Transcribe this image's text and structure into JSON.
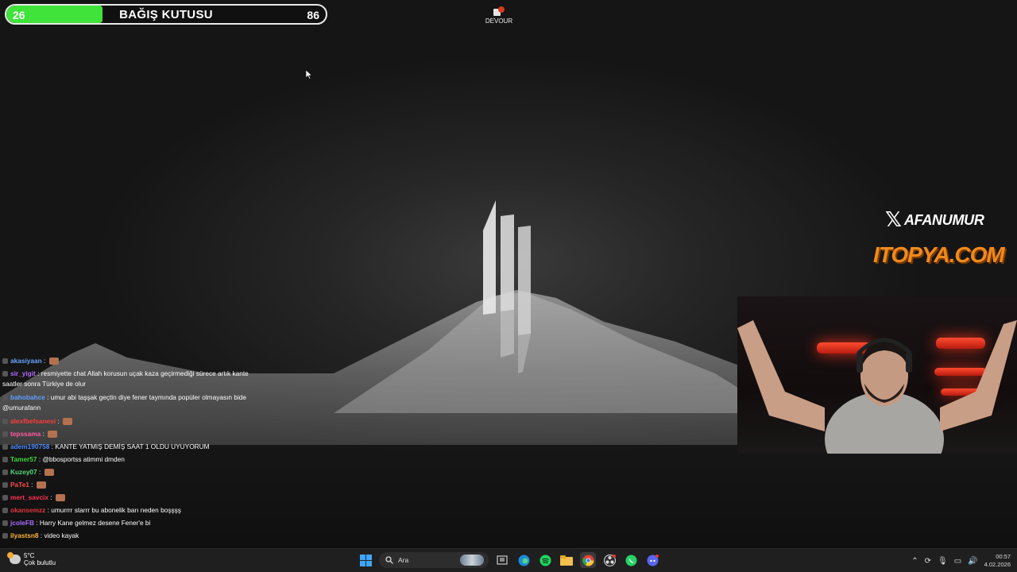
{
  "donation": {
    "current": "26",
    "title": "BAĞIŞ KUTUSU",
    "goal": "86",
    "progress_fraction": 0.3,
    "fill_color": "#3fe33a"
  },
  "desktop_icon": {
    "label": "DEVOUR",
    "icon": "devour-game-icon"
  },
  "overlay": {
    "x_handle": "AFANUMUR",
    "x_icon": "x-logo-icon",
    "sponsor": "ITOPYA.COM",
    "sponsor_color": "#f08a1c"
  },
  "chat": {
    "messages": [
      {
        "user": "akasiyaan",
        "sep": " : ",
        "text": "",
        "color": "#6aa2ff",
        "emote": true
      },
      {
        "user": "sir_yigit",
        "sep": " : ",
        "text": "resmiyette chat Allah korusun uçak kaza geçirmediği sürece artık kante saatler sonra Türkiye de olur",
        "color": "#b06bff",
        "emote": false
      },
      {
        "user": "bahobahce",
        "sep": " : ",
        "text": "umur abi taşşak geçtin diye fener taymında popüler olmayasın bide @umurafann",
        "color": "#5e9fff",
        "emote": false
      },
      {
        "user": "alexfbefsanesi",
        "sep": " : ",
        "text": "",
        "color": "#ff3b3b",
        "emote": true
      },
      {
        "user": "tepssama",
        "sep": " : ",
        "text": "",
        "color": "#ff5aa0",
        "emote": true
      },
      {
        "user": "adem190758",
        "sep": " : ",
        "text": "KANTE YATMIŞ DEMİŞ SAAT 1 OLDU UYUYORUM",
        "color": "#4f8dff",
        "emote": false
      },
      {
        "user": "Tamer57",
        "sep": " : ",
        "text": "@bbosportss atimmi dmden",
        "color": "#3fd63a",
        "emote": false
      },
      {
        "user": "Kuzey07",
        "sep": " : ",
        "text": "",
        "color": "#4fdc7a",
        "emote": true
      },
      {
        "user": "PaTe1",
        "sep": " : ",
        "text": "",
        "color": "#ff4a4a",
        "emote": true
      },
      {
        "user": "mert_savcix",
        "sep": " : ",
        "text": "",
        "color": "#ff3355",
        "emote": true
      },
      {
        "user": "okansemzz",
        "sep": " : ",
        "text": "umurrrr starrr bu abonelik barı neden boşşşş",
        "color": "#e2373d",
        "emote": false
      },
      {
        "user": "jcoleFB",
        "sep": " : ",
        "text": "Harry Kane gelmez desene Fener'e bi",
        "color": "#a66bff",
        "emote": false
      },
      {
        "user": "ilyastsn8",
        "sep": " : ",
        "text": "video kayak",
        "color": "#ffb43a",
        "emote": false
      }
    ]
  },
  "taskbar": {
    "weather_temp": "5°C",
    "weather_desc": "Çok bulutlu",
    "search_placeholder": "Ara",
    "time": "00:57",
    "date": "4.02.2026",
    "apps": [
      "start-icon",
      "task-view-icon",
      "edge-icon",
      "spotify-icon",
      "file-explorer-icon",
      "chrome-icon",
      "obs-icon",
      "whatsapp-icon",
      "discord-icon"
    ]
  }
}
